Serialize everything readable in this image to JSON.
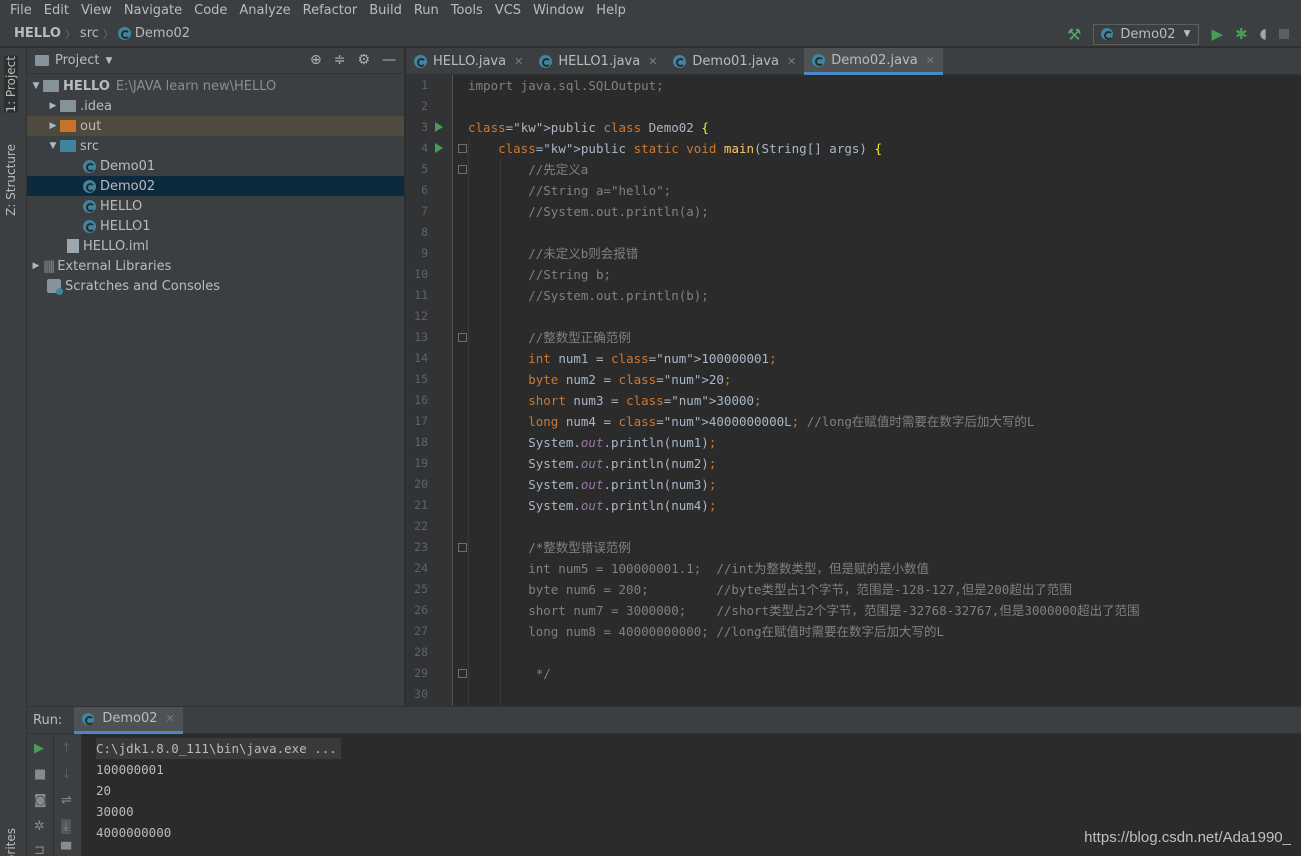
{
  "menu": [
    "File",
    "Edit",
    "View",
    "Navigate",
    "Code",
    "Analyze",
    "Refactor",
    "Build",
    "Run",
    "Tools",
    "VCS",
    "Window",
    "Help"
  ],
  "breadcrumb": {
    "project": "HELLO",
    "folder": "src",
    "file": "Demo02"
  },
  "run_config": "Demo02",
  "left_strip": {
    "project_tab": "1: Project",
    "structure_tab": "Z: Structure",
    "favorites_tab": "orites"
  },
  "project_panel": {
    "title": "Project",
    "tree": [
      {
        "label": "HELLO",
        "path": "E:\\JAVA learn new\\HELLO"
      },
      {
        "label": ".idea"
      },
      {
        "label": "out"
      },
      {
        "label": "src"
      },
      {
        "label": "Demo01"
      },
      {
        "label": "Demo02"
      },
      {
        "label": "HELLO"
      },
      {
        "label": "HELLO1"
      },
      {
        "label": "HELLO.iml"
      },
      {
        "label": "External Libraries"
      },
      {
        "label": "Scratches and Consoles"
      }
    ]
  },
  "editor_tabs": [
    "HELLO.java",
    "HELLO1.java",
    "Demo01.java",
    "Demo02.java"
  ],
  "code_lines": [
    "import java.sql.SQLOutput;",
    "",
    "public class Demo02 {",
    "    public static void main(String[] args) {",
    "        //先定义a",
    "        //String a=\"hello\";",
    "        //System.out.println(a);",
    "",
    "        //未定义b则会报错",
    "        //String b;",
    "        //System.out.println(b);",
    "",
    "        //整数型正确范例",
    "        int num1 = 100000001;",
    "        byte num2 = 20;",
    "        short num3 = 30000;",
    "        long num4 = 4000000000L; //long在赋值时需要在数字后加大写的L",
    "        System.out.println(num1);",
    "        System.out.println(num2);",
    "        System.out.println(num3);",
    "        System.out.println(num4);",
    "",
    "        /*整数型错误范例",
    "        int num5 = 100000001.1;  //int为整数类型，但是赋的是小数值",
    "        byte num6 = 200;         //byte类型占1个字节，范围是-128-127,但是200超出了范围",
    "        short num7 = 3000000;    //short类型占2个字节，范围是-32768-32767,但是3000000超出了范围",
    "        long num8 = 40000000000; //long在赋值时需要在数字后加大写的L",
    "",
    "         */",
    ""
  ],
  "run_panel": {
    "label": "Run:",
    "tab": "Demo02",
    "output": [
      "C:\\jdk1.8.0_111\\bin\\java.exe ...",
      "100000001",
      "20",
      "30000",
      "4000000000"
    ]
  },
  "watermark": "https://blog.csdn.net/Ada1990_"
}
